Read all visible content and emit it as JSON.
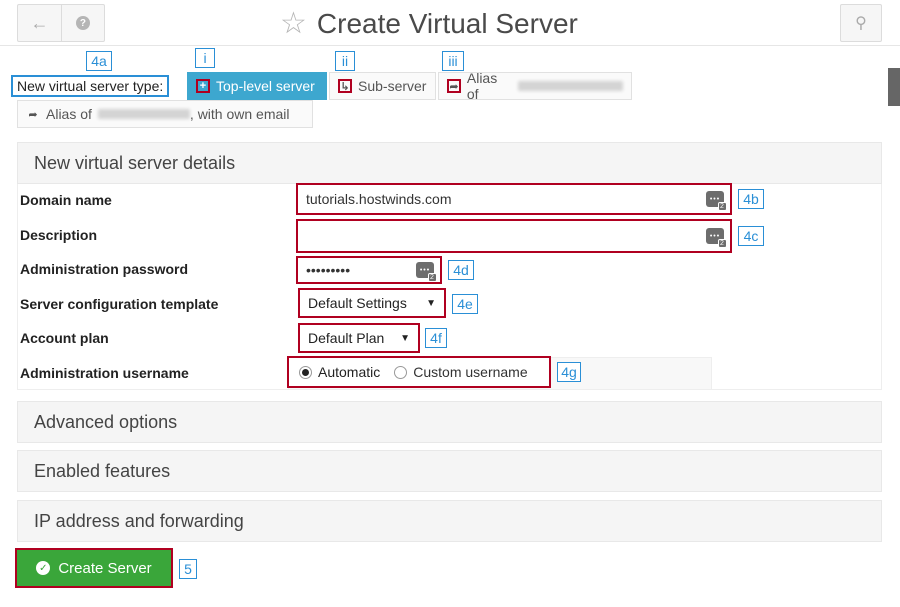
{
  "header": {
    "title": "Create Virtual Server",
    "back_icon": "arrow-left-icon",
    "help_icon": "help-icon",
    "favorite_icon": "star-icon",
    "right_icon": "key-plus-icon"
  },
  "server_type": {
    "label": "New virtual server type:",
    "options": [
      {
        "label": "Top-level server",
        "icon": "plus-square-icon",
        "active": true
      },
      {
        "label": "Sub-server",
        "icon": "sub-arrow-icon",
        "active": false
      },
      {
        "label": "Alias of",
        "icon": "share-arrow-icon",
        "active": false
      },
      {
        "label_prefix": "Alias of",
        "label_suffix": ", with own email",
        "icon": "share-arrow-icon",
        "active": false
      }
    ]
  },
  "details": {
    "heading": "New virtual server details",
    "fields": {
      "domain": {
        "label": "Domain name",
        "value": "tutorials.hostwinds.com"
      },
      "description": {
        "label": "Description",
        "value": ""
      },
      "password": {
        "label": "Administration password",
        "value": "•••••••••"
      },
      "template": {
        "label": "Server configuration template",
        "value": "Default Settings"
      },
      "plan": {
        "label": "Account plan",
        "value": "Default Plan"
      },
      "username": {
        "label": "Administration username",
        "option_auto": "Automatic",
        "option_custom": "Custom username",
        "selected": "Automatic"
      }
    }
  },
  "sections": {
    "advanced": "Advanced options",
    "features": "Enabled features",
    "ip": "IP address and forwarding"
  },
  "actions": {
    "create": "Create Server"
  },
  "callouts": {
    "a4a": "4a",
    "i": "i",
    "ii": "ii",
    "iii": "iii",
    "b4": "4b",
    "c4": "4c",
    "d4": "4d",
    "e4": "4e",
    "f4": "4f",
    "g4": "4g",
    "five": "5"
  },
  "key_icon_text": "•••",
  "key_icon_sub": "2"
}
